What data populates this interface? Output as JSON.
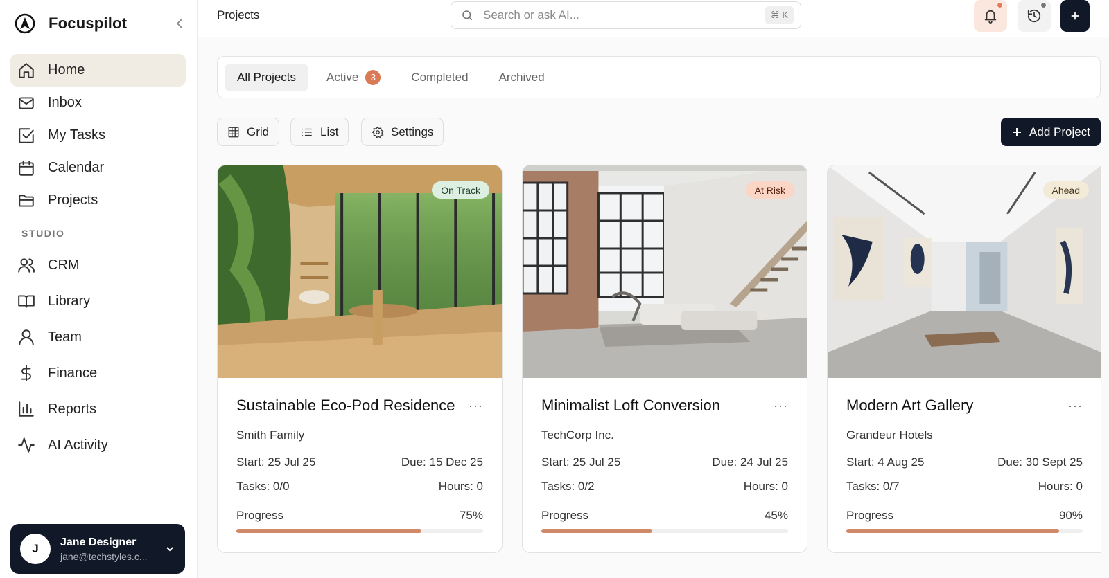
{
  "app": {
    "name": "Focuspilot"
  },
  "sidebar": {
    "items": [
      {
        "label": "Home",
        "icon": "home-icon",
        "active": true
      },
      {
        "label": "Inbox",
        "icon": "mail-icon"
      },
      {
        "label": "My Tasks",
        "icon": "check-square-icon"
      },
      {
        "label": "Calendar",
        "icon": "calendar-icon"
      },
      {
        "label": "Projects",
        "icon": "folder-icon"
      }
    ],
    "section_label": "STUDIO",
    "studio_items": [
      {
        "label": "CRM",
        "icon": "users-icon"
      },
      {
        "label": "Library",
        "icon": "book-icon"
      },
      {
        "label": "Team",
        "icon": "user-icon"
      },
      {
        "label": "Finance",
        "icon": "dollar-icon"
      },
      {
        "label": "Reports",
        "icon": "bar-chart-icon"
      },
      {
        "label": "AI Activity",
        "icon": "activity-icon"
      }
    ]
  },
  "user": {
    "initial": "J",
    "name": "Jane Designer",
    "email": "jane@techstyles.c..."
  },
  "header": {
    "breadcrumb": "Projects",
    "search_placeholder": "Search or ask AI...",
    "shortcut": "⌘ K",
    "colors": {
      "notification_dot": "#e8795a",
      "history_dot": "#777777"
    }
  },
  "tabs": [
    {
      "label": "All Projects",
      "active": true
    },
    {
      "label": "Active",
      "count": "3"
    },
    {
      "label": "Completed"
    },
    {
      "label": "Archived"
    }
  ],
  "view": {
    "grid_label": "Grid",
    "list_label": "List",
    "settings_label": "Settings",
    "add_label": "Add Project"
  },
  "projects": [
    {
      "title": "Sustainable Eco-Pod Residence",
      "client": "Smith Family",
      "start": "Start: 25 Jul 25",
      "due": "Due: 15 Dec 25",
      "tasks": "Tasks: 0/0",
      "hours": "Hours: 0",
      "progress_label": "Progress",
      "progress_text": "75%",
      "progress": 0.75,
      "status": "On Track",
      "status_bg": "#dcefe0",
      "status_color": "#1f3b2a"
    },
    {
      "title": "Minimalist Loft Conversion",
      "client": "TechCorp Inc.",
      "start": "Start: 25 Jul 25",
      "due": "Due: 24 Jul 25",
      "tasks": "Tasks: 0/2",
      "hours": "Hours: 0",
      "progress_label": "Progress",
      "progress_text": "45%",
      "progress": 0.45,
      "status": "At Risk",
      "status_bg": "#fbd6c7",
      "status_color": "#5a2412"
    },
    {
      "title": "Modern Art Gallery",
      "client": "Grandeur Hotels",
      "start": "Start: 4 Aug 25",
      "due": "Due: 30 Sept 25",
      "tasks": "Tasks: 0/7",
      "hours": "Hours: 0",
      "progress_label": "Progress",
      "progress_text": "90%",
      "progress": 0.9,
      "status": "Ahead",
      "status_bg": "#f3ead8",
      "status_color": "#4a3a1c"
    }
  ]
}
